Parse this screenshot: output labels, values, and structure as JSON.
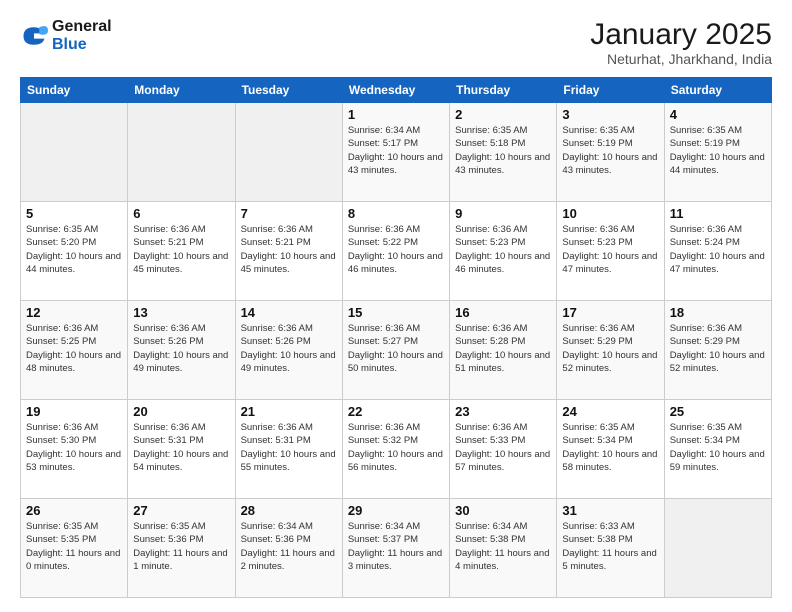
{
  "logo": {
    "line1": "General",
    "line2": "Blue"
  },
  "title": "January 2025",
  "subtitle": "Neturhat, Jharkhand, India",
  "weekdays": [
    "Sunday",
    "Monday",
    "Tuesday",
    "Wednesday",
    "Thursday",
    "Friday",
    "Saturday"
  ],
  "weeks": [
    [
      {
        "day": "",
        "sunrise": "",
        "sunset": "",
        "daylight": ""
      },
      {
        "day": "",
        "sunrise": "",
        "sunset": "",
        "daylight": ""
      },
      {
        "day": "",
        "sunrise": "",
        "sunset": "",
        "daylight": ""
      },
      {
        "day": "1",
        "sunrise": "Sunrise: 6:34 AM",
        "sunset": "Sunset: 5:17 PM",
        "daylight": "Daylight: 10 hours and 43 minutes."
      },
      {
        "day": "2",
        "sunrise": "Sunrise: 6:35 AM",
        "sunset": "Sunset: 5:18 PM",
        "daylight": "Daylight: 10 hours and 43 minutes."
      },
      {
        "day": "3",
        "sunrise": "Sunrise: 6:35 AM",
        "sunset": "Sunset: 5:19 PM",
        "daylight": "Daylight: 10 hours and 43 minutes."
      },
      {
        "day": "4",
        "sunrise": "Sunrise: 6:35 AM",
        "sunset": "Sunset: 5:19 PM",
        "daylight": "Daylight: 10 hours and 44 minutes."
      }
    ],
    [
      {
        "day": "5",
        "sunrise": "Sunrise: 6:35 AM",
        "sunset": "Sunset: 5:20 PM",
        "daylight": "Daylight: 10 hours and 44 minutes."
      },
      {
        "day": "6",
        "sunrise": "Sunrise: 6:36 AM",
        "sunset": "Sunset: 5:21 PM",
        "daylight": "Daylight: 10 hours and 45 minutes."
      },
      {
        "day": "7",
        "sunrise": "Sunrise: 6:36 AM",
        "sunset": "Sunset: 5:21 PM",
        "daylight": "Daylight: 10 hours and 45 minutes."
      },
      {
        "day": "8",
        "sunrise": "Sunrise: 6:36 AM",
        "sunset": "Sunset: 5:22 PM",
        "daylight": "Daylight: 10 hours and 46 minutes."
      },
      {
        "day": "9",
        "sunrise": "Sunrise: 6:36 AM",
        "sunset": "Sunset: 5:23 PM",
        "daylight": "Daylight: 10 hours and 46 minutes."
      },
      {
        "day": "10",
        "sunrise": "Sunrise: 6:36 AM",
        "sunset": "Sunset: 5:23 PM",
        "daylight": "Daylight: 10 hours and 47 minutes."
      },
      {
        "day": "11",
        "sunrise": "Sunrise: 6:36 AM",
        "sunset": "Sunset: 5:24 PM",
        "daylight": "Daylight: 10 hours and 47 minutes."
      }
    ],
    [
      {
        "day": "12",
        "sunrise": "Sunrise: 6:36 AM",
        "sunset": "Sunset: 5:25 PM",
        "daylight": "Daylight: 10 hours and 48 minutes."
      },
      {
        "day": "13",
        "sunrise": "Sunrise: 6:36 AM",
        "sunset": "Sunset: 5:26 PM",
        "daylight": "Daylight: 10 hours and 49 minutes."
      },
      {
        "day": "14",
        "sunrise": "Sunrise: 6:36 AM",
        "sunset": "Sunset: 5:26 PM",
        "daylight": "Daylight: 10 hours and 49 minutes."
      },
      {
        "day": "15",
        "sunrise": "Sunrise: 6:36 AM",
        "sunset": "Sunset: 5:27 PM",
        "daylight": "Daylight: 10 hours and 50 minutes."
      },
      {
        "day": "16",
        "sunrise": "Sunrise: 6:36 AM",
        "sunset": "Sunset: 5:28 PM",
        "daylight": "Daylight: 10 hours and 51 minutes."
      },
      {
        "day": "17",
        "sunrise": "Sunrise: 6:36 AM",
        "sunset": "Sunset: 5:29 PM",
        "daylight": "Daylight: 10 hours and 52 minutes."
      },
      {
        "day": "18",
        "sunrise": "Sunrise: 6:36 AM",
        "sunset": "Sunset: 5:29 PM",
        "daylight": "Daylight: 10 hours and 52 minutes."
      }
    ],
    [
      {
        "day": "19",
        "sunrise": "Sunrise: 6:36 AM",
        "sunset": "Sunset: 5:30 PM",
        "daylight": "Daylight: 10 hours and 53 minutes."
      },
      {
        "day": "20",
        "sunrise": "Sunrise: 6:36 AM",
        "sunset": "Sunset: 5:31 PM",
        "daylight": "Daylight: 10 hours and 54 minutes."
      },
      {
        "day": "21",
        "sunrise": "Sunrise: 6:36 AM",
        "sunset": "Sunset: 5:31 PM",
        "daylight": "Daylight: 10 hours and 55 minutes."
      },
      {
        "day": "22",
        "sunrise": "Sunrise: 6:36 AM",
        "sunset": "Sunset: 5:32 PM",
        "daylight": "Daylight: 10 hours and 56 minutes."
      },
      {
        "day": "23",
        "sunrise": "Sunrise: 6:36 AM",
        "sunset": "Sunset: 5:33 PM",
        "daylight": "Daylight: 10 hours and 57 minutes."
      },
      {
        "day": "24",
        "sunrise": "Sunrise: 6:35 AM",
        "sunset": "Sunset: 5:34 PM",
        "daylight": "Daylight: 10 hours and 58 minutes."
      },
      {
        "day": "25",
        "sunrise": "Sunrise: 6:35 AM",
        "sunset": "Sunset: 5:34 PM",
        "daylight": "Daylight: 10 hours and 59 minutes."
      }
    ],
    [
      {
        "day": "26",
        "sunrise": "Sunrise: 6:35 AM",
        "sunset": "Sunset: 5:35 PM",
        "daylight": "Daylight: 11 hours and 0 minutes."
      },
      {
        "day": "27",
        "sunrise": "Sunrise: 6:35 AM",
        "sunset": "Sunset: 5:36 PM",
        "daylight": "Daylight: 11 hours and 1 minute."
      },
      {
        "day": "28",
        "sunrise": "Sunrise: 6:34 AM",
        "sunset": "Sunset: 5:36 PM",
        "daylight": "Daylight: 11 hours and 2 minutes."
      },
      {
        "day": "29",
        "sunrise": "Sunrise: 6:34 AM",
        "sunset": "Sunset: 5:37 PM",
        "daylight": "Daylight: 11 hours and 3 minutes."
      },
      {
        "day": "30",
        "sunrise": "Sunrise: 6:34 AM",
        "sunset": "Sunset: 5:38 PM",
        "daylight": "Daylight: 11 hours and 4 minutes."
      },
      {
        "day": "31",
        "sunrise": "Sunrise: 6:33 AM",
        "sunset": "Sunset: 5:38 PM",
        "daylight": "Daylight: 11 hours and 5 minutes."
      },
      {
        "day": "",
        "sunrise": "",
        "sunset": "",
        "daylight": ""
      }
    ]
  ]
}
